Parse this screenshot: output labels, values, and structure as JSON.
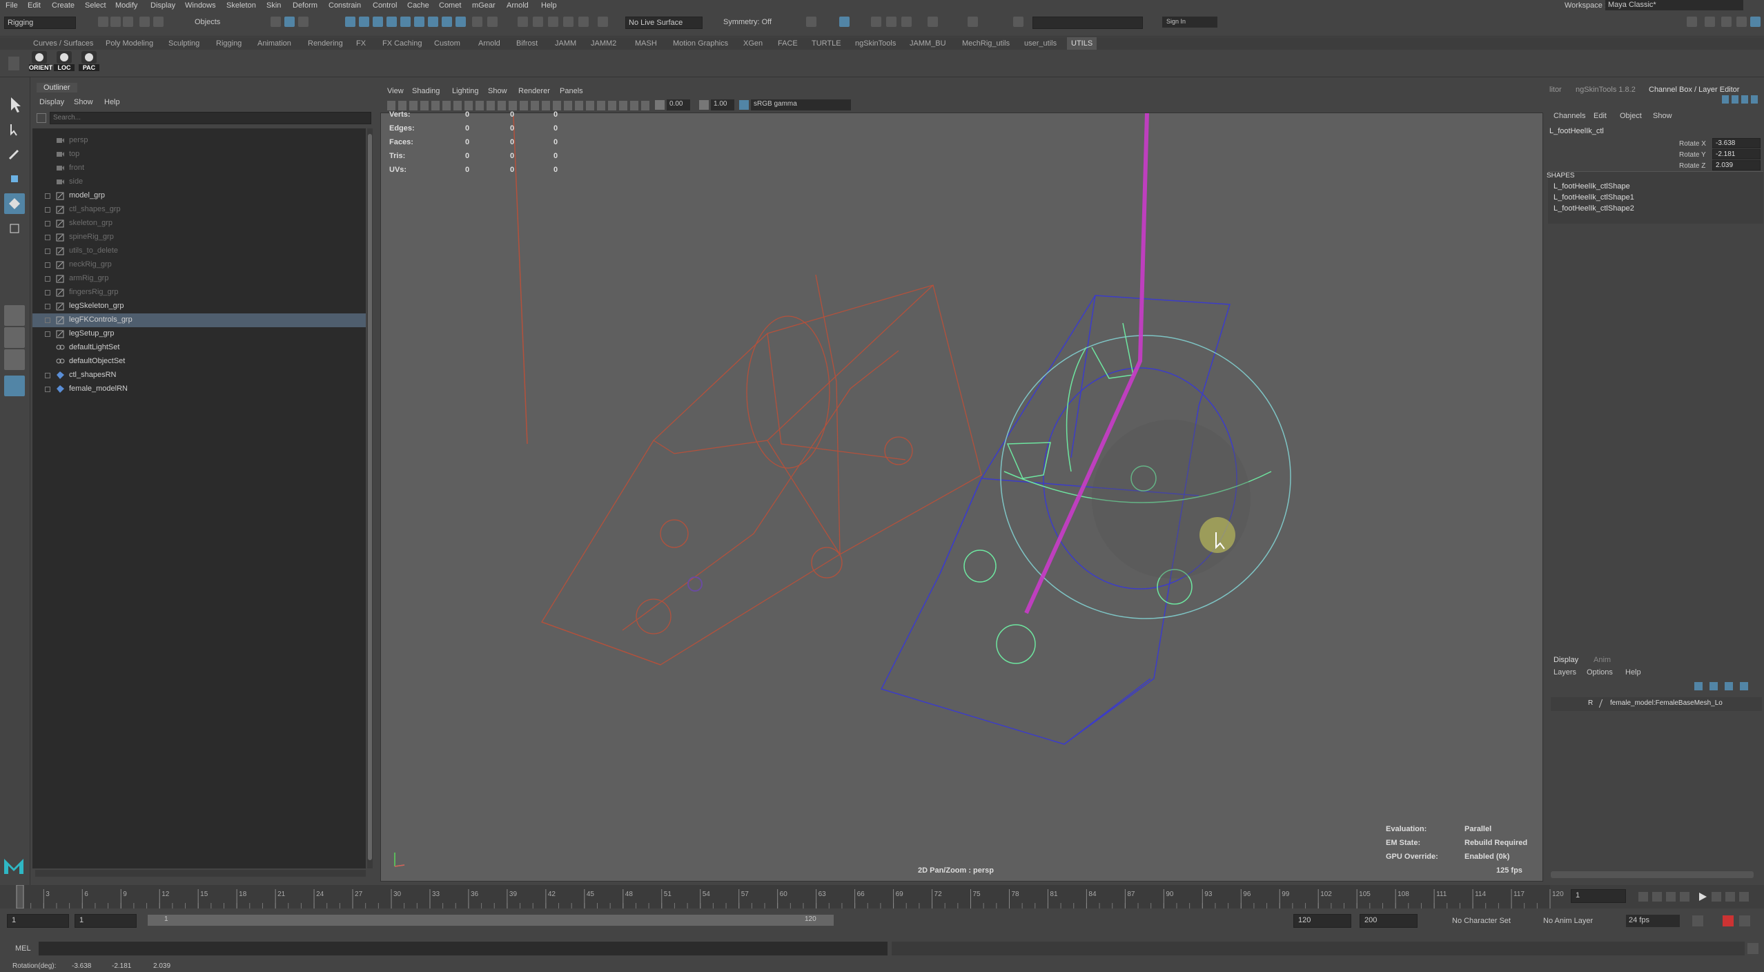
{
  "menubar": {
    "items": [
      "File",
      "Edit",
      "Create",
      "Select",
      "Modify",
      "Display",
      "Windows",
      "Skeleton",
      "Skin",
      "Deform",
      "Constrain",
      "Control",
      "Cache",
      "Comet",
      "mGear",
      "Arnold",
      "Help"
    ],
    "workspace_label": "Workspace :",
    "workspace_value": "Maya Classic*"
  },
  "statusline": {
    "menuset": "Rigging",
    "select_mode": "Objects",
    "live_surface": "No Live Surface",
    "symmetry": "Symmetry: Off",
    "sign_in": "Sign In"
  },
  "shelf": {
    "tabs": [
      "Curves / Surfaces",
      "Poly Modeling",
      "Sculpting",
      "Rigging",
      "Animation",
      "Rendering",
      "FX",
      "FX Caching",
      "Custom",
      "Arnold",
      "Bifrost",
      "JAMM",
      "JAMM2",
      "MASH",
      "Motion Graphics",
      "XGen",
      "FACE",
      "TURTLE",
      "ngSkinTools",
      "JAMM_BU",
      "MechRig_utils",
      "user_utils",
      "UTILS"
    ],
    "active_tab": "UTILS",
    "buttons": [
      "ORIENT",
      "LOC",
      "PAC"
    ]
  },
  "outliner": {
    "title": "Outliner",
    "menus": [
      "Display",
      "Show",
      "Help"
    ],
    "search_placeholder": "Search...",
    "items": [
      {
        "label": "persp",
        "dim": true,
        "expandable": false,
        "icon": "camera"
      },
      {
        "label": "top",
        "dim": true,
        "expandable": false,
        "icon": "camera"
      },
      {
        "label": "front",
        "dim": true,
        "expandable": false,
        "icon": "camera"
      },
      {
        "label": "side",
        "dim": true,
        "expandable": false,
        "icon": "camera"
      },
      {
        "label": "model_grp",
        "dim": false,
        "expandable": true,
        "icon": "group"
      },
      {
        "label": "ctl_shapes_grp",
        "dim": true,
        "expandable": true,
        "icon": "group"
      },
      {
        "label": "skeleton_grp",
        "dim": true,
        "expandable": true,
        "icon": "group"
      },
      {
        "label": "spineRig_grp",
        "dim": true,
        "expandable": true,
        "icon": "group"
      },
      {
        "label": "utils_to_delete",
        "dim": true,
        "expandable": true,
        "icon": "group"
      },
      {
        "label": "neckRig_grp",
        "dim": true,
        "expandable": true,
        "icon": "group"
      },
      {
        "label": "armRig_grp",
        "dim": true,
        "expandable": true,
        "icon": "group"
      },
      {
        "label": "fingersRig_grp",
        "dim": true,
        "expandable": true,
        "icon": "group"
      },
      {
        "label": "legSkeleton_grp",
        "dim": false,
        "expandable": true,
        "icon": "group"
      },
      {
        "label": "legFKControls_grp",
        "dim": false,
        "expandable": true,
        "icon": "group",
        "selected": true
      },
      {
        "label": "legSetup_grp",
        "dim": false,
        "expandable": true,
        "icon": "group"
      },
      {
        "label": "defaultLightSet",
        "dim": false,
        "expandable": false,
        "icon": "set"
      },
      {
        "label": "defaultObjectSet",
        "dim": false,
        "expandable": false,
        "icon": "set"
      },
      {
        "label": "ctl_shapesRN",
        "dim": false,
        "expandable": true,
        "icon": "reference"
      },
      {
        "label": "female_modelRN",
        "dim": false,
        "expandable": true,
        "icon": "reference"
      }
    ]
  },
  "viewport": {
    "menus": [
      "View",
      "Shading",
      "Lighting",
      "Show",
      "Renderer",
      "Panels"
    ],
    "field_a": "0.00",
    "field_b": "1.00",
    "colorspace": "sRGB gamma",
    "hud": [
      {
        "label": "Verts:",
        "v": [
          "0",
          "0",
          "0"
        ]
      },
      {
        "label": "Edges:",
        "v": [
          "0",
          "0",
          "0"
        ]
      },
      {
        "label": "Faces:",
        "v": [
          "0",
          "0",
          "0"
        ]
      },
      {
        "label": "Tris:",
        "v": [
          "0",
          "0",
          "0"
        ]
      },
      {
        "label": "UVs:",
        "v": [
          "0",
          "0",
          "0"
        ]
      }
    ],
    "camera_label": "2D Pan/Zoom : persp",
    "eval": {
      "evaluation_label": "Evaluation:",
      "evaluation": "Parallel",
      "em_label": "EM State:",
      "em": "Rebuild Required",
      "gpu_label": "GPU Override:",
      "gpu": "Enabled (0k)",
      "fps": "125 fps"
    }
  },
  "channelbox": {
    "tabs": [
      "litor",
      "ngSkinTools 1.8.2",
      "Channel Box / Layer Editor"
    ],
    "menus": [
      "Channels",
      "Edit",
      "Object",
      "Show"
    ],
    "object": "L_footHeelIk_ctl",
    "attrs": [
      {
        "name": "Rotate X",
        "value": "-3.638"
      },
      {
        "name": "Rotate Y",
        "value": "-2.181"
      },
      {
        "name": "Rotate Z",
        "value": "2.039"
      }
    ],
    "shapes_header": "SHAPES",
    "shapes": [
      "L_footHeelIk_ctlShape",
      "L_footHeelIk_ctlShape1",
      "L_footHeelIk_ctlShape2"
    ]
  },
  "layers": {
    "tabs": [
      "Display",
      "Anim"
    ],
    "menus": [
      "Layers",
      "Options",
      "Help"
    ],
    "row_flag": "R",
    "row_label": "female_model:FemaleBaseMesh_Lo"
  },
  "timeline": {
    "ticks": [
      "1",
      "3",
      "6",
      "9",
      "12",
      "15",
      "18",
      "21",
      "24",
      "27",
      "30",
      "33",
      "36",
      "39",
      "42",
      "45",
      "48",
      "51",
      "54",
      "57",
      "60",
      "63",
      "66",
      "69",
      "72",
      "75",
      "78",
      "81",
      "84",
      "87",
      "90",
      "93",
      "96",
      "99",
      "102",
      "105",
      "108",
      "111",
      "114",
      "117",
      "120"
    ],
    "current_frame": "1"
  },
  "range": {
    "start": "1",
    "playback_start": "1",
    "slider_start": "1",
    "slider_end": "120",
    "playback_end": "120",
    "end": "200",
    "character_set": "No Character Set",
    "anim_layer": "No Anim Layer",
    "fps": "24 fps"
  },
  "commandline": {
    "label": "MEL"
  },
  "helpline": {
    "label": "Rotation(deg):",
    "x": "-3.638",
    "y": "-2.181",
    "z": "2.039"
  },
  "colors": {
    "accent": "#5285a6",
    "selection": "#4f5e6e",
    "wire_red": "#b4513c",
    "wire_blue": "#3c3cc8",
    "wire_green": "#6ee6a0",
    "wire_magenta": "#c93cc9"
  }
}
